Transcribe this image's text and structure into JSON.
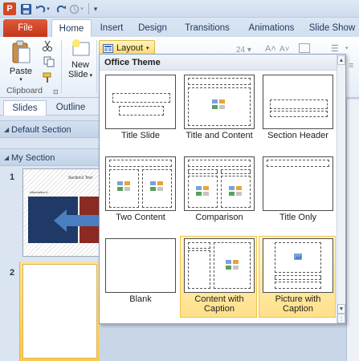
{
  "app_logo_letter": "P",
  "tabs": [
    "File",
    "Home",
    "Insert",
    "Design",
    "Transitions",
    "Animations",
    "Slide Show"
  ],
  "ribbon": {
    "paste_label": "Paste",
    "new_slide_label_1": "New",
    "new_slide_label_2": "Slide",
    "clipboard_group": "Clipboard",
    "layout_label": "Layout",
    "font_size": "24"
  },
  "left_pane": {
    "tabs": [
      "Slides",
      "Outline"
    ],
    "sections": [
      "Default Section",
      "My Section"
    ],
    "slide_numbers": [
      "1",
      "2"
    ],
    "slide1_title": "Section1 Text",
    "slide1_label": "Alternative A"
  },
  "gallery": {
    "header": "Office Theme",
    "layouts": [
      {
        "name": "Title Slide"
      },
      {
        "name": "Title and Content"
      },
      {
        "name": "Section Header"
      },
      {
        "name": "Two Content"
      },
      {
        "name": "Comparison"
      },
      {
        "name": "Title Only"
      },
      {
        "name": "Blank"
      },
      {
        "name": "Content with Caption"
      },
      {
        "name": "Picture with Caption"
      }
    ]
  },
  "colors": {
    "file_tab": "#d24726",
    "highlight": "#ffe08a",
    "slide_blue": "#1f3a66",
    "slide_red": "#8b2a22",
    "arrow_blue": "#4a7fc1"
  }
}
